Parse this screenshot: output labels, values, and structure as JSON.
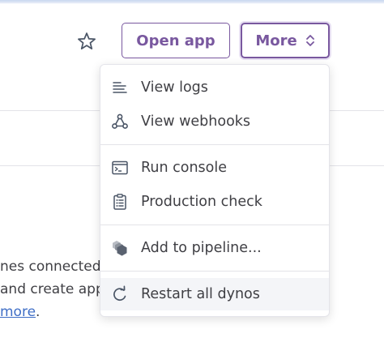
{
  "header": {
    "open_app_label": "Open app",
    "more_label": "More",
    "favorite_icon": "star-icon",
    "more_icon": "chevron-up-down-icon"
  },
  "background": {
    "line1": "nes connected",
    "line2": "and create app",
    "link": "more",
    "link_suffix": "."
  },
  "menu": {
    "groups": [
      [
        {
          "label": "View logs",
          "icon": "logs-icon"
        },
        {
          "label": "View webhooks",
          "icon": "webhooks-icon"
        }
      ],
      [
        {
          "label": "Run console",
          "icon": "console-icon"
        },
        {
          "label": "Production check",
          "icon": "clipboard-check-icon"
        }
      ],
      [
        {
          "label": "Add to pipeline...",
          "icon": "pipeline-icon"
        }
      ],
      [
        {
          "label": "Restart all dynos",
          "icon": "restart-icon"
        }
      ]
    ]
  },
  "colors": {
    "accent": "#79589f",
    "link": "#3f6ec6",
    "text": "#3f3f44",
    "hover_bg": "#f4f5f8"
  }
}
